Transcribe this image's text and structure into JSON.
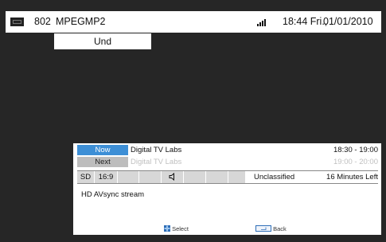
{
  "topbar": {
    "channel_number": "802",
    "service_name": "MPEGMP2",
    "time": "18:44 Fri.,",
    "date": "01/01/2010"
  },
  "subtab": {
    "label": "Und"
  },
  "epg": {
    "now": {
      "label": "Now",
      "title": "Digital TV Labs",
      "time": "18:30 - 19:00"
    },
    "next": {
      "label": "Next",
      "title": "Digital TV Labs",
      "time": "19:00 - 20:00"
    }
  },
  "info": {
    "definition": "SD",
    "aspect": "16:9",
    "rating": "Unclassified",
    "remaining": "16 Minutes Left"
  },
  "description": "HD AVsync stream",
  "footer": {
    "select_label": "Select",
    "back_label": "Back"
  },
  "colors": {
    "background": "#262626",
    "now_tag": "#3d8fd6",
    "next_tag": "#bdbdbd"
  },
  "icons": [
    "tv-icon",
    "signal-icon",
    "audio-icon",
    "select-icon",
    "back-icon"
  ]
}
